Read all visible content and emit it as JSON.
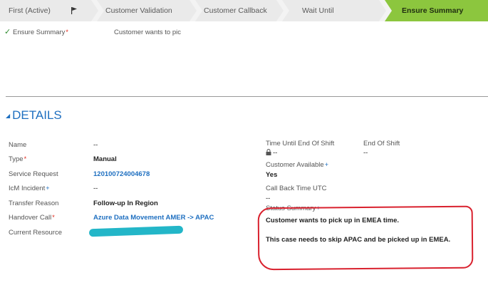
{
  "process_bar": {
    "stages": [
      {
        "label": "First (Active)"
      },
      {
        "label": "Customer Validation"
      },
      {
        "label": "Customer Callback"
      },
      {
        "label": "Wait Until"
      },
      {
        "label": "Ensure Summary"
      }
    ],
    "active_color": "#8cc63e"
  },
  "stage_row": {
    "field_label": "Ensure Summary",
    "field_value": "Customer wants to pic"
  },
  "details": {
    "title": "DETAILS",
    "left_fields": [
      {
        "label": "Name",
        "value": "--"
      },
      {
        "label": "Type",
        "value": "Manual"
      },
      {
        "label": "Service Request",
        "value": "120100724004678"
      },
      {
        "label": "IcM Incident",
        "value": "--"
      },
      {
        "label": "Transfer Reason",
        "value": "Follow-up In Region"
      },
      {
        "label": "Handover Call",
        "value": "Azure Data Movement AMER -> APAC"
      },
      {
        "label": "Current Resource",
        "value": ""
      }
    ],
    "right_fields": {
      "time_until_label": "Time Until End Of Shift",
      "time_until_value": "--",
      "end_of_shift_label": "End Of Shift",
      "end_of_shift_value": "--",
      "customer_available_label": "Customer Available",
      "customer_available_value": "Yes",
      "callback_label": "Call Back Time UTC",
      "callback_value": "--",
      "status_summary_label": "Status Summary",
      "status_summary_line1": "Customer wants to pick up in EMEA time.",
      "status_summary_line2": "This case needs to skip APAC and be picked up in EMEA."
    }
  },
  "colors": {
    "link": "#1e6fc0",
    "required": "#e0271a",
    "annotation": "#d9212e",
    "redaction": "#23b6c8"
  }
}
